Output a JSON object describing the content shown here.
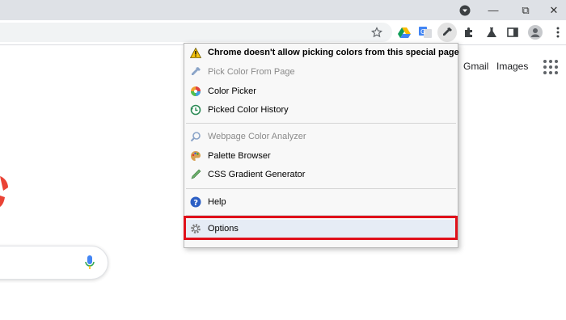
{
  "browser": {
    "window_controls": {
      "profile_menu_icon": "profile-dropdown-icon",
      "minimize_icon": "—",
      "restore_icon": "⧉",
      "close_icon": "✕"
    },
    "toolbar_icons": [
      "star-icon",
      "google-drive-icon",
      "google-translate-icon",
      "eyedropper-extension-icon",
      "extensions-puzzle-icon",
      "labs-flask-icon",
      "side-panel-icon",
      "profile-avatar-icon",
      "more-menu-icon"
    ]
  },
  "google_page": {
    "links": {
      "gmail": "Gmail",
      "images": "Images"
    }
  },
  "context_menu": {
    "warning": "Chrome doesn't allow picking colors from this special page",
    "groups": [
      [
        {
          "label": "Pick Color From Page",
          "disabled": true,
          "icon": "eyedropper-icon"
        },
        {
          "label": "Color Picker",
          "disabled": false,
          "icon": "color-wheel-icon"
        },
        {
          "label": "Picked Color History",
          "disabled": false,
          "icon": "history-icon"
        }
      ],
      [
        {
          "label": "Webpage Color Analyzer",
          "disabled": true,
          "icon": "magnifier-icon"
        },
        {
          "label": "Palette Browser",
          "disabled": false,
          "icon": "palette-icon"
        },
        {
          "label": "CSS Gradient Generator",
          "disabled": false,
          "icon": "gradient-pen-icon"
        }
      ],
      [
        {
          "label": "Help",
          "disabled": false,
          "icon": "help-icon"
        }
      ],
      [
        {
          "label": "Options",
          "disabled": false,
          "icon": "gear-icon",
          "highlighted": true
        }
      ]
    ]
  },
  "colors": {
    "highlight_border": "#e0101a",
    "menu_background": "#f8f8f8",
    "disabled_text": "#8a8a8a"
  }
}
